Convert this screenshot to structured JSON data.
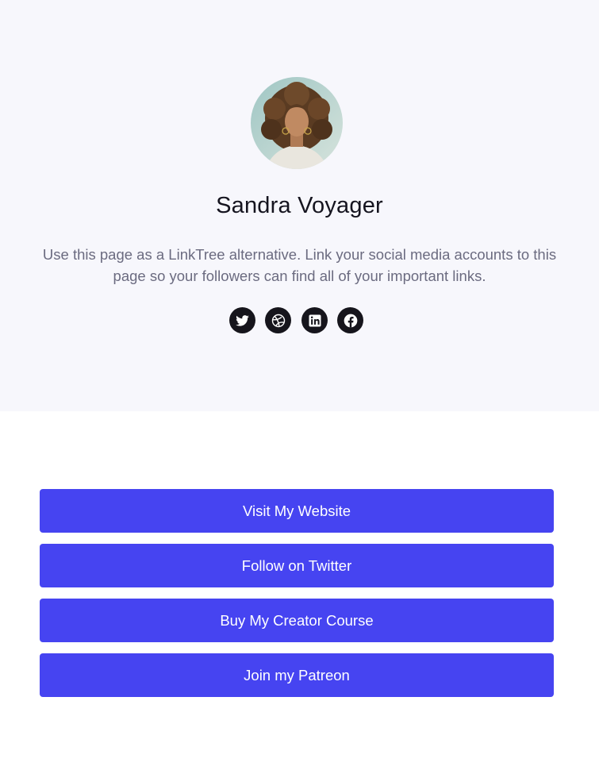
{
  "profile": {
    "name": "Sandra Voyager",
    "bio": "Use this page as a LinkTree alternative. Link your social media accounts to this page so your followers can find all of your important links."
  },
  "socials": [
    {
      "icon": "twitter-icon"
    },
    {
      "icon": "dribbble-icon"
    },
    {
      "icon": "linkedin-icon"
    },
    {
      "icon": "facebook-icon"
    }
  ],
  "links": [
    {
      "label": "Visit My Website"
    },
    {
      "label": "Follow on Twitter"
    },
    {
      "label": "Buy My Creator Course"
    },
    {
      "label": "Join my Patreon"
    }
  ],
  "colors": {
    "hero_background": "#f7f7fc",
    "button": "#4644f1",
    "social_icon_bg": "#16151c",
    "name_text": "#15141f",
    "bio_text": "#6b6b80"
  }
}
